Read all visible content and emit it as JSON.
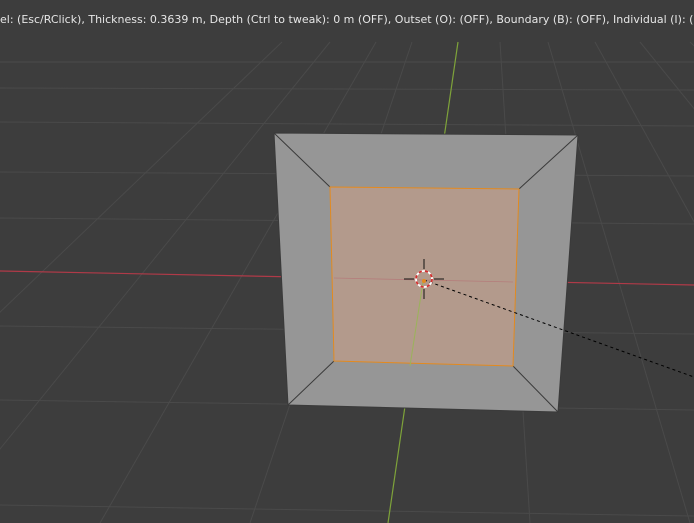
{
  "header_status": {
    "text": "el: (Esc/RClick), Thickness: 0.3639 m, Depth (Ctrl to tweak): 0 m (OFF), Outset (O): (OFF), Boundary (B): (OFF), Individual (I): (ON)"
  },
  "viewport": {
    "background": "#3d3d3d",
    "grid_color": "#4a4a4a",
    "x_axis_color": "#b03a48",
    "y_axis_color": "#7ea33a",
    "mesh_face_color": "#969696",
    "selected_face_color": "#b39a8c",
    "selection_edge_color": "#e38a1f",
    "cursor_icon": "3d-cursor-icon"
  }
}
